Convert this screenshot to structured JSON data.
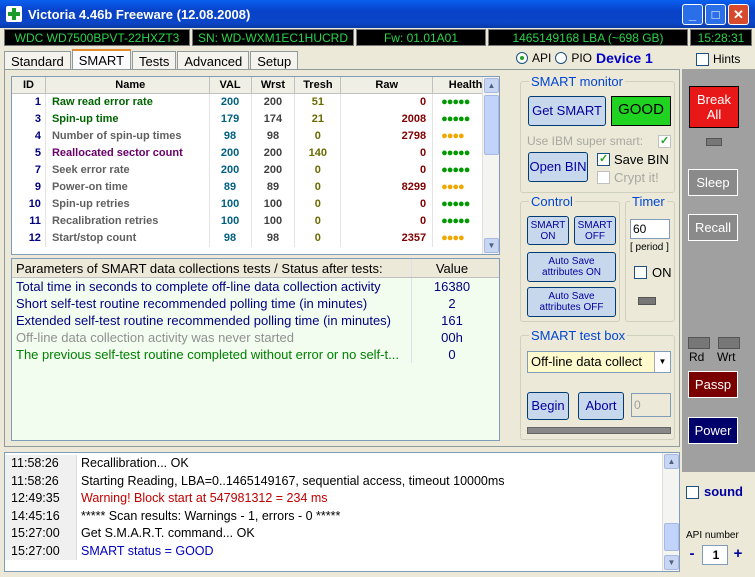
{
  "window": {
    "title": "Victoria 4.46b Freeware (12.08.2008)",
    "minimize": "_",
    "maximize": "□",
    "close": "✕"
  },
  "info": {
    "model": "WDC WD7500BPVT-22HXZT3",
    "serial": "SN: WD-WXM1EC1HUCRD",
    "firmware": "Fw: 01.01A01",
    "lba": "1465149168 LBA (~698 GB)",
    "clock": "15:28:31"
  },
  "tabs": [
    "Standard",
    "SMART",
    "Tests",
    "Advanced",
    "Setup"
  ],
  "active_tab": "SMART",
  "mode": {
    "api": "API",
    "pio": "PIO",
    "device": "Device 1"
  },
  "hints_label": "Hints",
  "smart_table": {
    "headers": {
      "id": "ID",
      "name": "Name",
      "val": "VAL",
      "wrst": "Wrst",
      "tresh": "Tresh",
      "raw": "Raw",
      "health": "Health"
    },
    "rows": [
      {
        "id": "1",
        "name": "Raw read error rate",
        "val": "200",
        "wrst": "200",
        "tresh": "51",
        "raw": "0",
        "health": "●●●●●",
        "color": "#006400"
      },
      {
        "id": "3",
        "name": "Spin-up time",
        "val": "179",
        "wrst": "174",
        "tresh": "21",
        "raw": "2008",
        "health": "●●●●●",
        "color": "#006400"
      },
      {
        "id": "4",
        "name": "Number of spin-up times",
        "val": "98",
        "wrst": "98",
        "tresh": "0",
        "raw": "2798",
        "health": "●●●●",
        "color": "#606060"
      },
      {
        "id": "5",
        "name": "Reallocated sector count",
        "val": "200",
        "wrst": "200",
        "tresh": "140",
        "raw": "0",
        "health": "●●●●●",
        "color": "#6a006a"
      },
      {
        "id": "7",
        "name": "Seek error rate",
        "val": "200",
        "wrst": "200",
        "tresh": "0",
        "raw": "0",
        "health": "●●●●●",
        "color": "#606060"
      },
      {
        "id": "9",
        "name": "Power-on time",
        "val": "89",
        "wrst": "89",
        "tresh": "0",
        "raw": "8299",
        "health": "●●●●",
        "color": "#606060"
      },
      {
        "id": "10",
        "name": "Spin-up retries",
        "val": "100",
        "wrst": "100",
        "tresh": "0",
        "raw": "0",
        "health": "●●●●●",
        "color": "#606060"
      },
      {
        "id": "11",
        "name": "Recalibration retries",
        "val": "100",
        "wrst": "100",
        "tresh": "0",
        "raw": "0",
        "health": "●●●●●",
        "color": "#606060"
      },
      {
        "id": "12",
        "name": "Start/stop count",
        "val": "98",
        "wrst": "98",
        "tresh": "0",
        "raw": "2357",
        "health": "●●●●",
        "color": "#606060"
      }
    ]
  },
  "params": {
    "header": "Parameters of SMART data collections tests / Status after tests:",
    "value_header": "Value",
    "rows": [
      {
        "label": "Total time in seconds to complete off-line data collection activity",
        "value": "16380",
        "color": "#000080"
      },
      {
        "label": "Short self-test routine recommended polling time (in minutes)",
        "value": "2",
        "color": "#000080"
      },
      {
        "label": "Extended self-test routine recommended polling time (in minutes)",
        "value": "161",
        "color": "#000080"
      },
      {
        "label": "Off-line data collection activity was never started",
        "value": "00h",
        "color": "#909090"
      },
      {
        "label": "The previous self-test routine completed without error or no self-t...",
        "value": "0",
        "color": "#008000"
      }
    ]
  },
  "smart_monitor": {
    "title": "SMART monitor",
    "get_smart": "Get SMART",
    "status": "GOOD",
    "ibm_label": "Use IBM super smart:",
    "open_bin": "Open BIN",
    "save_bin": "Save BIN",
    "crypt": "Crypt it!"
  },
  "control": {
    "title": "Control",
    "smart_on": "SMART ON",
    "smart_off": "SMART OFF",
    "auto_on": "Auto Save attributes ON",
    "auto_off": "Auto Save attributes OFF"
  },
  "timer": {
    "title": "Timer",
    "value": "60",
    "period": "[ period ]",
    "on": "ON"
  },
  "test_box": {
    "title": "SMART test box",
    "selected": "Off-line data collect",
    "begin": "Begin",
    "abort": "Abort",
    "value": "0"
  },
  "side": {
    "break": "Break All",
    "sleep": "Sleep",
    "recall": "Recall",
    "rd": "Rd",
    "wrt": "Wrt",
    "passp": "Passp",
    "power": "Power",
    "sound": "sound",
    "api_number_label": "API number",
    "api_number": "1",
    "minus": "-",
    "plus": "+"
  },
  "log": [
    {
      "time": "11:58:26",
      "msg": "Recallibration... OK",
      "color": "#000000"
    },
    {
      "time": "11:58:26",
      "msg": "Starting Reading, LBA=0..1465149167, sequential access, timeout 10000ms",
      "color": "#000000"
    },
    {
      "time": "12:49:35",
      "msg": "Warning! Block start at 547981312 = 234 ms",
      "color": "#c00000"
    },
    {
      "time": "14:45:16",
      "msg": "***** Scan results: Warnings - 1, errors - 0 *****",
      "color": "#000000"
    },
    {
      "time": "15:27:00",
      "msg": "Get S.M.A.R.T. command... OK",
      "color": "#000000"
    },
    {
      "time": "15:27:00",
      "msg": "SMART status = GOOD",
      "color": "#0000c0"
    }
  ]
}
